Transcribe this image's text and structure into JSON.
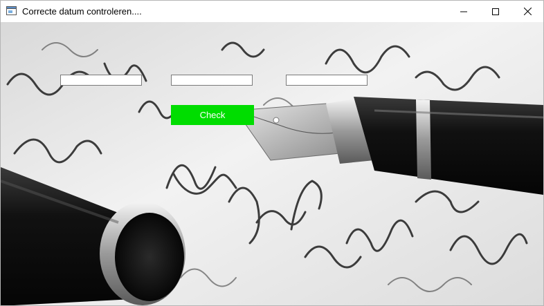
{
  "window": {
    "title": "Correcte datum controleren....",
    "app_icon": "window-icon",
    "controls": {
      "minimize_icon": "minimize-icon",
      "maximize_icon": "maximize-icon",
      "close_icon": "close-icon"
    }
  },
  "form": {
    "field_1": {
      "value": "",
      "placeholder": ""
    },
    "field_2": {
      "value": "",
      "placeholder": ""
    },
    "field_3": {
      "value": "",
      "placeholder": ""
    },
    "check_label": "Check"
  },
  "colors": {
    "check_button": "#00dd00",
    "check_text": "#ffffff"
  }
}
